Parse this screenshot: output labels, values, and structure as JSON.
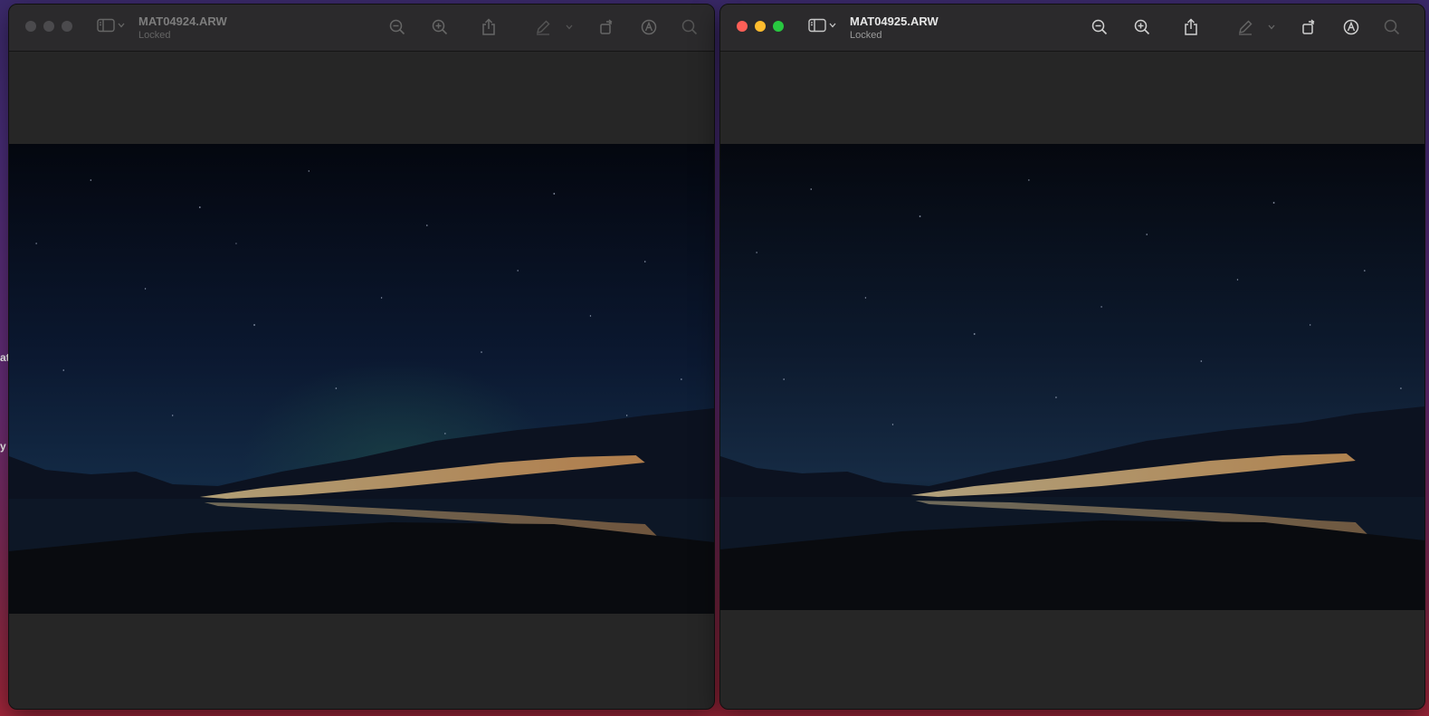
{
  "desktop": {
    "fragments": [
      "at",
      "y"
    ]
  },
  "windows": [
    {
      "id": "left",
      "filename": "MAT04924.ARW",
      "status": "Locked",
      "active": false
    },
    {
      "id": "right",
      "filename": "MAT04925.ARW",
      "status": "Locked",
      "active": true
    }
  ],
  "toolbar": {
    "icons": [
      "sidebar-icon",
      "chevron-down-icon",
      "zoom-out-icon",
      "zoom-in-icon",
      "share-icon",
      "markup-pen-icon",
      "chevron-down-icon",
      "rotate-icon",
      "annotate-icon",
      "search-icon"
    ]
  },
  "colors": {
    "window_bg": "#252525",
    "titlebar_bg": "#2b2a2c",
    "close": "#ff5f57",
    "minimize": "#febc2e",
    "zoom": "#28c840"
  }
}
